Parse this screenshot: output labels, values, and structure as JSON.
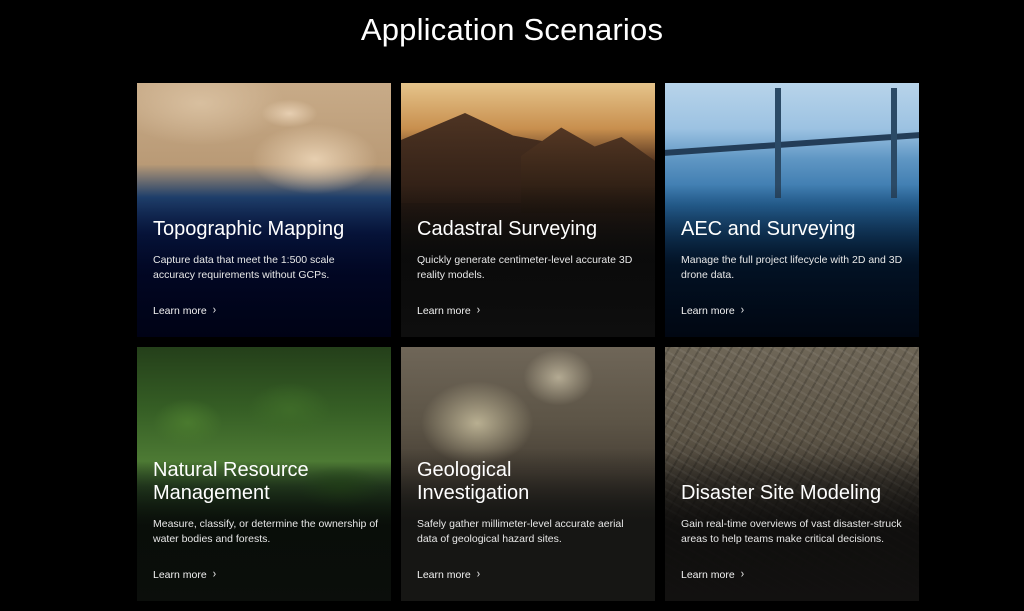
{
  "page": {
    "title": "Application Scenarios"
  },
  "cards": [
    {
      "title": "Topographic Mapping",
      "description": "Capture data that meet the 1:500 scale accuracy requirements without GCPs.",
      "link": "Learn more"
    },
    {
      "title": "Cadastral Surveying",
      "description": "Quickly generate centimeter-level accurate 3D reality models.",
      "link": "Learn more"
    },
    {
      "title": "AEC and Surveying",
      "description": "Manage the full project lifecycle with 2D and 3D drone data.",
      "link": "Learn more"
    },
    {
      "title_line1": "Natural Resource",
      "title_line2": "Management",
      "description": "Measure, classify, or determine the ownership of water bodies and forests.",
      "link": "Learn more"
    },
    {
      "title_line1": "Geological",
      "title_line2": "Investigation",
      "description": "Safely gather millimeter-level accurate aerial data of geological hazard sites.",
      "link": "Learn more"
    },
    {
      "title": "Disaster Site Modeling",
      "description": "Gain real-time overviews of vast disaster-struck areas to help teams make critical decisions.",
      "link": "Learn more"
    }
  ],
  "icons": {
    "link_arrow": "chevron-right-icon"
  }
}
